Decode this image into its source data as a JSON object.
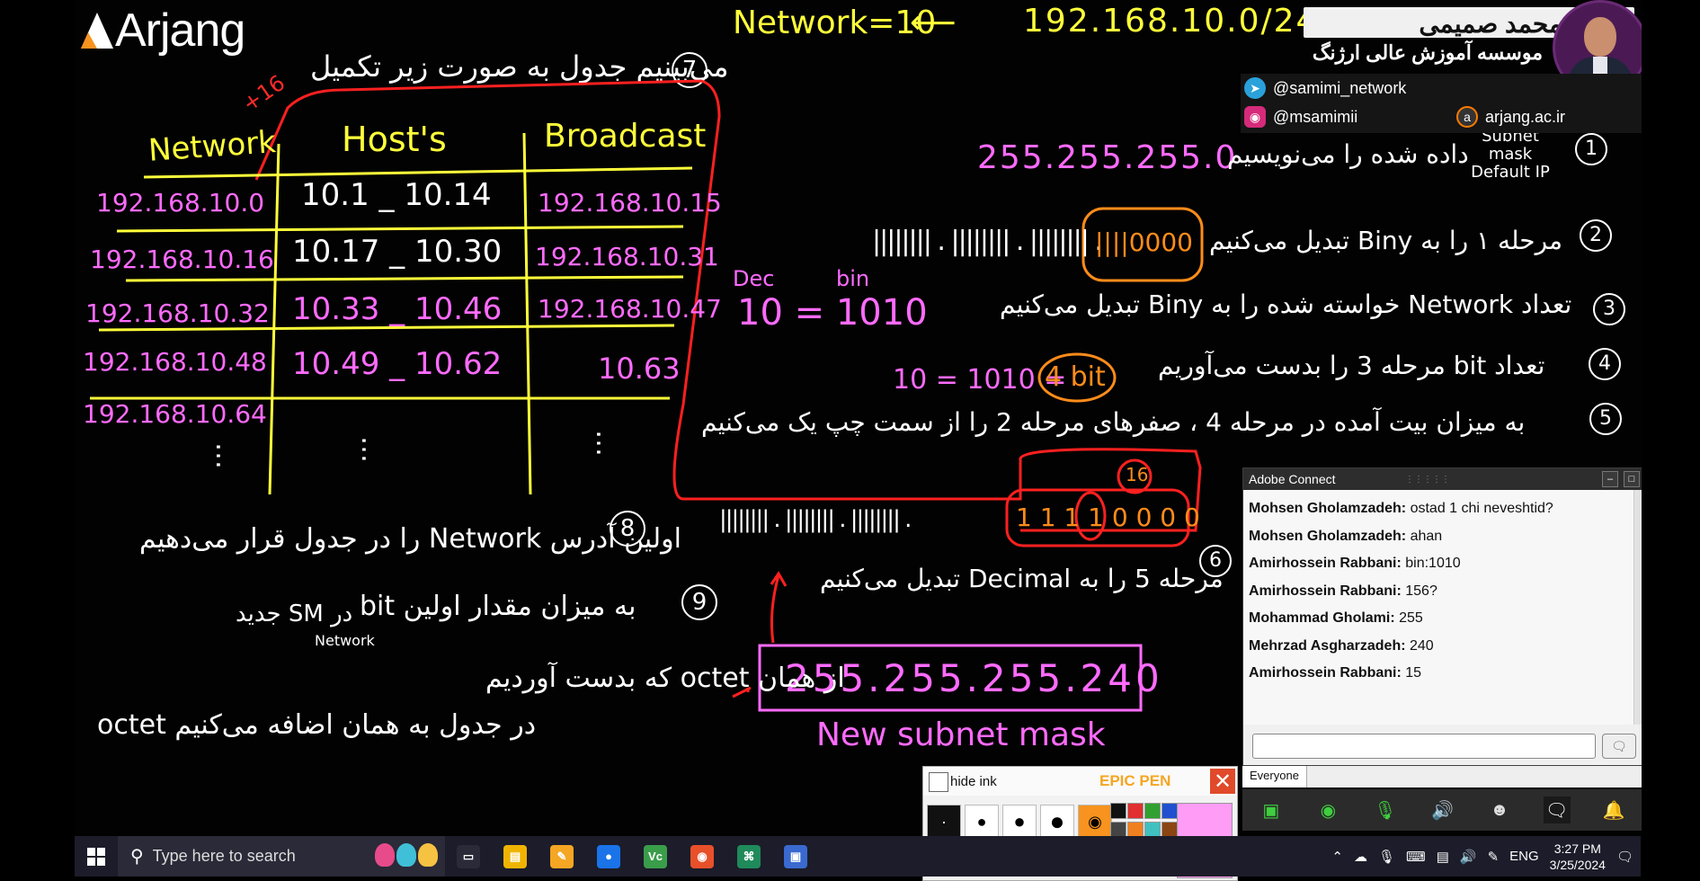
{
  "logo": {
    "text": "Arjang"
  },
  "board": {
    "topline": {
      "left": "Network=10",
      "arrow": "⟵",
      "right": "192.168.10.0/24"
    },
    "step7": "می‌بینیم جدول به صورت زیر تکمیل",
    "step7_num": "7",
    "plus16": "+16",
    "table": {
      "headers": [
        "Network",
        "Host's",
        "Broadcast"
      ],
      "rows": [
        [
          "192.168.10.0",
          "10.1 _ 10.14",
          "192.168.10.15"
        ],
        [
          "192.168.10.16",
          "10.17 _ 10.30",
          "192.168.10.31"
        ],
        [
          "192.168.10.32",
          "10.33 _ 10.46",
          "192.168.10.47"
        ],
        [
          "192.168.10.48",
          "10.49 _ 10.62",
          "10.63"
        ],
        [
          "192.168.10.64",
          "",
          ""
        ]
      ],
      "dots": "…"
    },
    "steps": [
      {
        "num": "1",
        "text": "داده شده را می‌نویسیم",
        "extra": "Subnet mask Default IP",
        "value": "255.255.255.0"
      },
      {
        "num": "2",
        "text": "مرحله ۱ را به Biny تبدیل می‌کنیم",
        "bits": "|||||||| . |||||||| . |||||||| . ",
        "circled": "||||0000"
      },
      {
        "num": "3",
        "text": "تعداد Network خواسته شده را به Biny تبدیل می‌کنیم"
      },
      {
        "num": "4",
        "text": "تعداد bit مرحله 3 را بدست می‌آوریم"
      },
      {
        "num": "5",
        "text": "به میزان بیت آمده در مرحله 4 ، صفرهای مرحله 2 را از سمت چپ یک می‌کنیم"
      },
      {
        "num": "6",
        "text": "مرحله 5 را به Decimal تبدیل می‌کنیم"
      }
    ],
    "dec_label": "Dec",
    "bin_label": "bin",
    "dec_eq": "10  =  1010",
    "bit_eq": "10 = 1010 =",
    "bit_circle": "4 bit",
    "step5_bits": "|||||||| . |||||||| . |||||||| . ",
    "step5_circled": "1 1 1 1 0 0 0 0",
    "step5_16": "16",
    "result": "255.255.255.240",
    "result_caption": "New subnet mask",
    "step8_num": "8",
    "step8": "اولین آدرس Network را در جدول قرار می‌دهیم",
    "step9_num": "9",
    "step9_a": "به میزان مقدار اولین bit",
    "step9_b": "در SM جدید",
    "step9_network": "Network",
    "step9_c": "از همان octet که بدست آوردیم",
    "step9_d": "octet در جدول به همان اضافه می‌کنیم"
  },
  "presenter": {
    "name": "محمد صمیمی",
    "institute": "موسسه آموزش عالی ارژنگ",
    "telegram": "@samimi_network",
    "instagram": "@msamimii",
    "site": "arjang.ac.ir"
  },
  "adobe_connect": {
    "title": "Adobe Connect",
    "messages": [
      {
        "user": "Mohsen Gholamzadeh:",
        "text": " ostad 1 chi neveshtid?"
      },
      {
        "user": "Mohsen Gholamzadeh:",
        "text": " ahan"
      },
      {
        "user": "Amirhossein Rabbani:",
        "text": " bin:1010"
      },
      {
        "user": "Amirhossein Rabbani:",
        "text": " 156?"
      },
      {
        "user": "Mohammad Gholami:",
        "text": " 255"
      },
      {
        "user": "Mehrzad Asgharzadeh:",
        "text": " 240"
      },
      {
        "user": "Amirhossein Rabbani:",
        "text": " 15"
      }
    ],
    "audience": "Everyone"
  },
  "epic_pen": {
    "hide_label": "hide ink",
    "title": "EPIC PEN",
    "palette": [
      "#111111",
      "#e03030",
      "#30a030",
      "#2050d0",
      "#444444",
      "#f08020",
      "#40c0c0",
      "#8b4513",
      "#777777",
      "#e080e0",
      "#f0e020",
      "#a040c0",
      "#bbbbbb",
      "#ff90f0",
      "#90e060",
      "#ffffff"
    ],
    "active_color": "#ff9cf5"
  },
  "taskbar": {
    "search_placeholder": "Type here to search",
    "apps": [
      {
        "name": "task-view",
        "color": "#2a2a38",
        "glyph": "▭"
      },
      {
        "name": "file-explorer",
        "color": "#f0b400",
        "glyph": "▤"
      },
      {
        "name": "epic-pen",
        "color": "#f5a623",
        "glyph": "✎"
      },
      {
        "name": "chrome",
        "color": "#1a73e8",
        "glyph": "●"
      },
      {
        "name": "vc-app",
        "color": "#3a9d4a",
        "glyph": "Vc"
      },
      {
        "name": "record-app",
        "color": "#e8502a",
        "glyph": "◉"
      },
      {
        "name": "green-app",
        "color": "#1f8a5a",
        "glyph": "⌘"
      },
      {
        "name": "network-app",
        "color": "#3a6ad0",
        "glyph": "▣"
      }
    ],
    "lang": "ENG",
    "time": "3:27 PM",
    "date": "3/25/2024"
  }
}
